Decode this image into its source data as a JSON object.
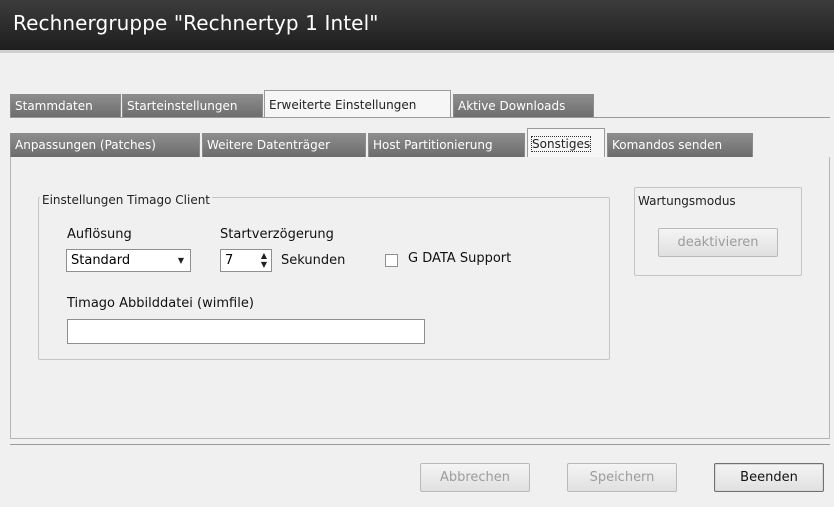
{
  "window": {
    "title": "Rechnergruppe \"Rechnertyp 1 Intel\""
  },
  "tabs_row1": [
    {
      "label": "Stammdaten",
      "active": false
    },
    {
      "label": "Starteinstellungen",
      "active": false
    },
    {
      "label": "Erweiterte Einstellungen",
      "active": true
    },
    {
      "label": "Aktive Downloads",
      "active": false
    }
  ],
  "tabs_row2": [
    {
      "label": "Anpassungen (Patches)",
      "active": false
    },
    {
      "label": "Weitere Datenträger",
      "active": false
    },
    {
      "label": "Host Partitionierung",
      "active": false
    },
    {
      "label": "Sonstiges",
      "active": true
    },
    {
      "label": "Komandos senden",
      "active": false
    }
  ],
  "client_group": {
    "title": "Einstellungen Timago Client",
    "resolution_label": "Auflösung",
    "resolution_value": "Standard",
    "delay_label": "Startverzögerung",
    "delay_value": "7",
    "delay_unit": "Sekunden",
    "gdata_label": "G DATA Support",
    "gdata_checked": false,
    "wimfile_label": "Timago Abbilddatei (wimfile)",
    "wimfile_value": ""
  },
  "maintenance_group": {
    "title": "Wartungsmodus",
    "button_label": "deaktivieren"
  },
  "footer": {
    "cancel_label": "Abbrechen",
    "save_label": "Speichern",
    "close_label": "Beenden"
  }
}
